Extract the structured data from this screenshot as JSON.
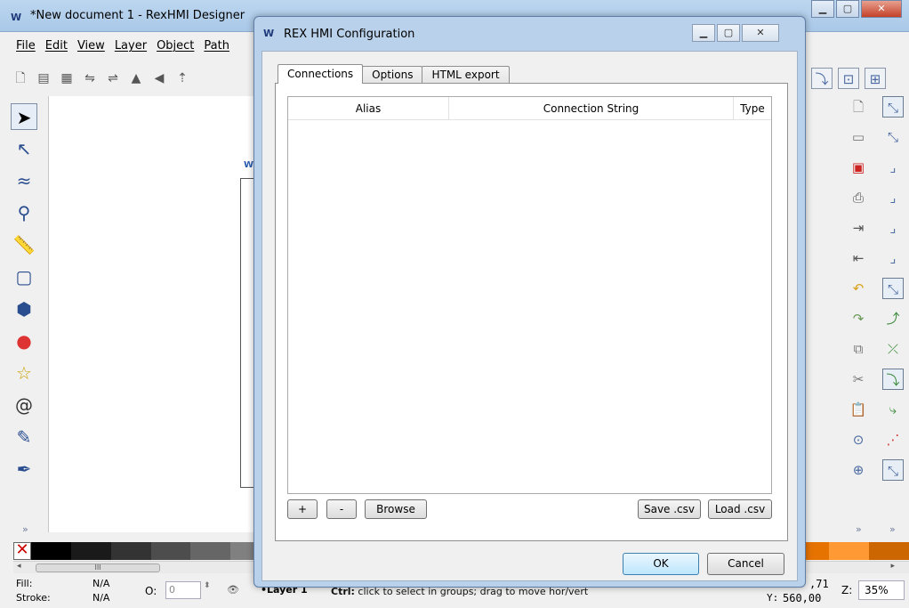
{
  "background_app": {
    "title": "*New document 1 - RexHMI Designer",
    "menu": [
      "File",
      "Edit",
      "View",
      "Layer",
      "Object",
      "Path"
    ],
    "more_label": "»",
    "scroll_thumb": "III",
    "status": {
      "fill_label": "Fill:",
      "fill_value": "N/A",
      "stroke_label": "Stroke:",
      "stroke_value": "N/A",
      "opacity_label": "O:",
      "opacity_value": "0",
      "layer": "•Layer 1",
      "message_bold": "Ctrl:",
      "message": " click to select in groups; drag to move hor/vert",
      "x_value": ",71",
      "y_label": "Y:",
      "y_value": "560,00",
      "zoom_label": "Z:",
      "zoom_value": "35%"
    },
    "palette_colors": [
      "#000000",
      "#1a1a1a",
      "#333333",
      "#4d4d4d",
      "#666666",
      "#808080",
      "#999999",
      "#b3b3b3",
      "#cccccc",
      "#e6e6e6",
      "#800000",
      "#aa2200",
      "#d45500",
      "#ff6600",
      "#ff8800",
      "#aa4400",
      "#803300",
      "#552200",
      "#b35900",
      "#e67300",
      "#ff9933",
      "#cc6600"
    ]
  },
  "dialog": {
    "title": "REX HMI Configuration",
    "tabs": [
      {
        "label": "Connections",
        "active": true
      },
      {
        "label": "Options",
        "active": false
      },
      {
        "label": "HTML export",
        "active": false
      }
    ],
    "table": {
      "columns": [
        "Alias",
        "Connection String",
        "Type"
      ],
      "rows": []
    },
    "buttons": {
      "add": "+",
      "remove": "-",
      "browse": "Browse",
      "save_csv": "Save .csv",
      "load_csv": "Load .csv",
      "ok": "OK",
      "cancel": "Cancel"
    }
  }
}
